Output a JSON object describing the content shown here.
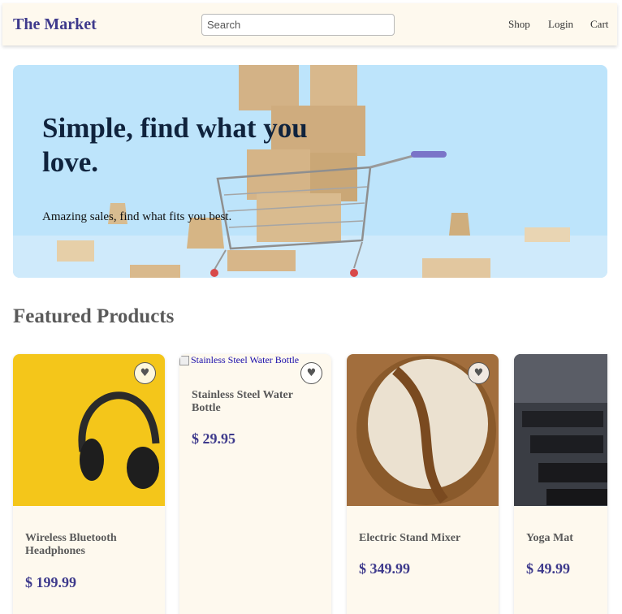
{
  "header": {
    "brand": "The Market",
    "search_placeholder": "Search",
    "nav": [
      "Shop",
      "Login",
      "Cart"
    ]
  },
  "hero": {
    "title": "Simple, find what you love.",
    "subtitle": "Amazing sales, find what fits you best."
  },
  "featured": {
    "title": "Featured Products",
    "favorite_icon": "♥",
    "products": [
      {
        "name": "Wireless Bluetooth Headphones",
        "price": "$ 199.99"
      },
      {
        "name": "Stainless Steel Water Bottle",
        "price": "$ 29.95",
        "image_alt": "Stainless Steel Water Bottle"
      },
      {
        "name": "Electric Stand Mixer",
        "price": "$ 349.99"
      },
      {
        "name": "Yoga Mat",
        "price": "$ 49.99"
      }
    ]
  },
  "colors": {
    "brand": "#3e3a8c",
    "header_bg": "#fef9ee",
    "hero_bg": "#bde4fb",
    "card_bg": "#fef9ee"
  }
}
